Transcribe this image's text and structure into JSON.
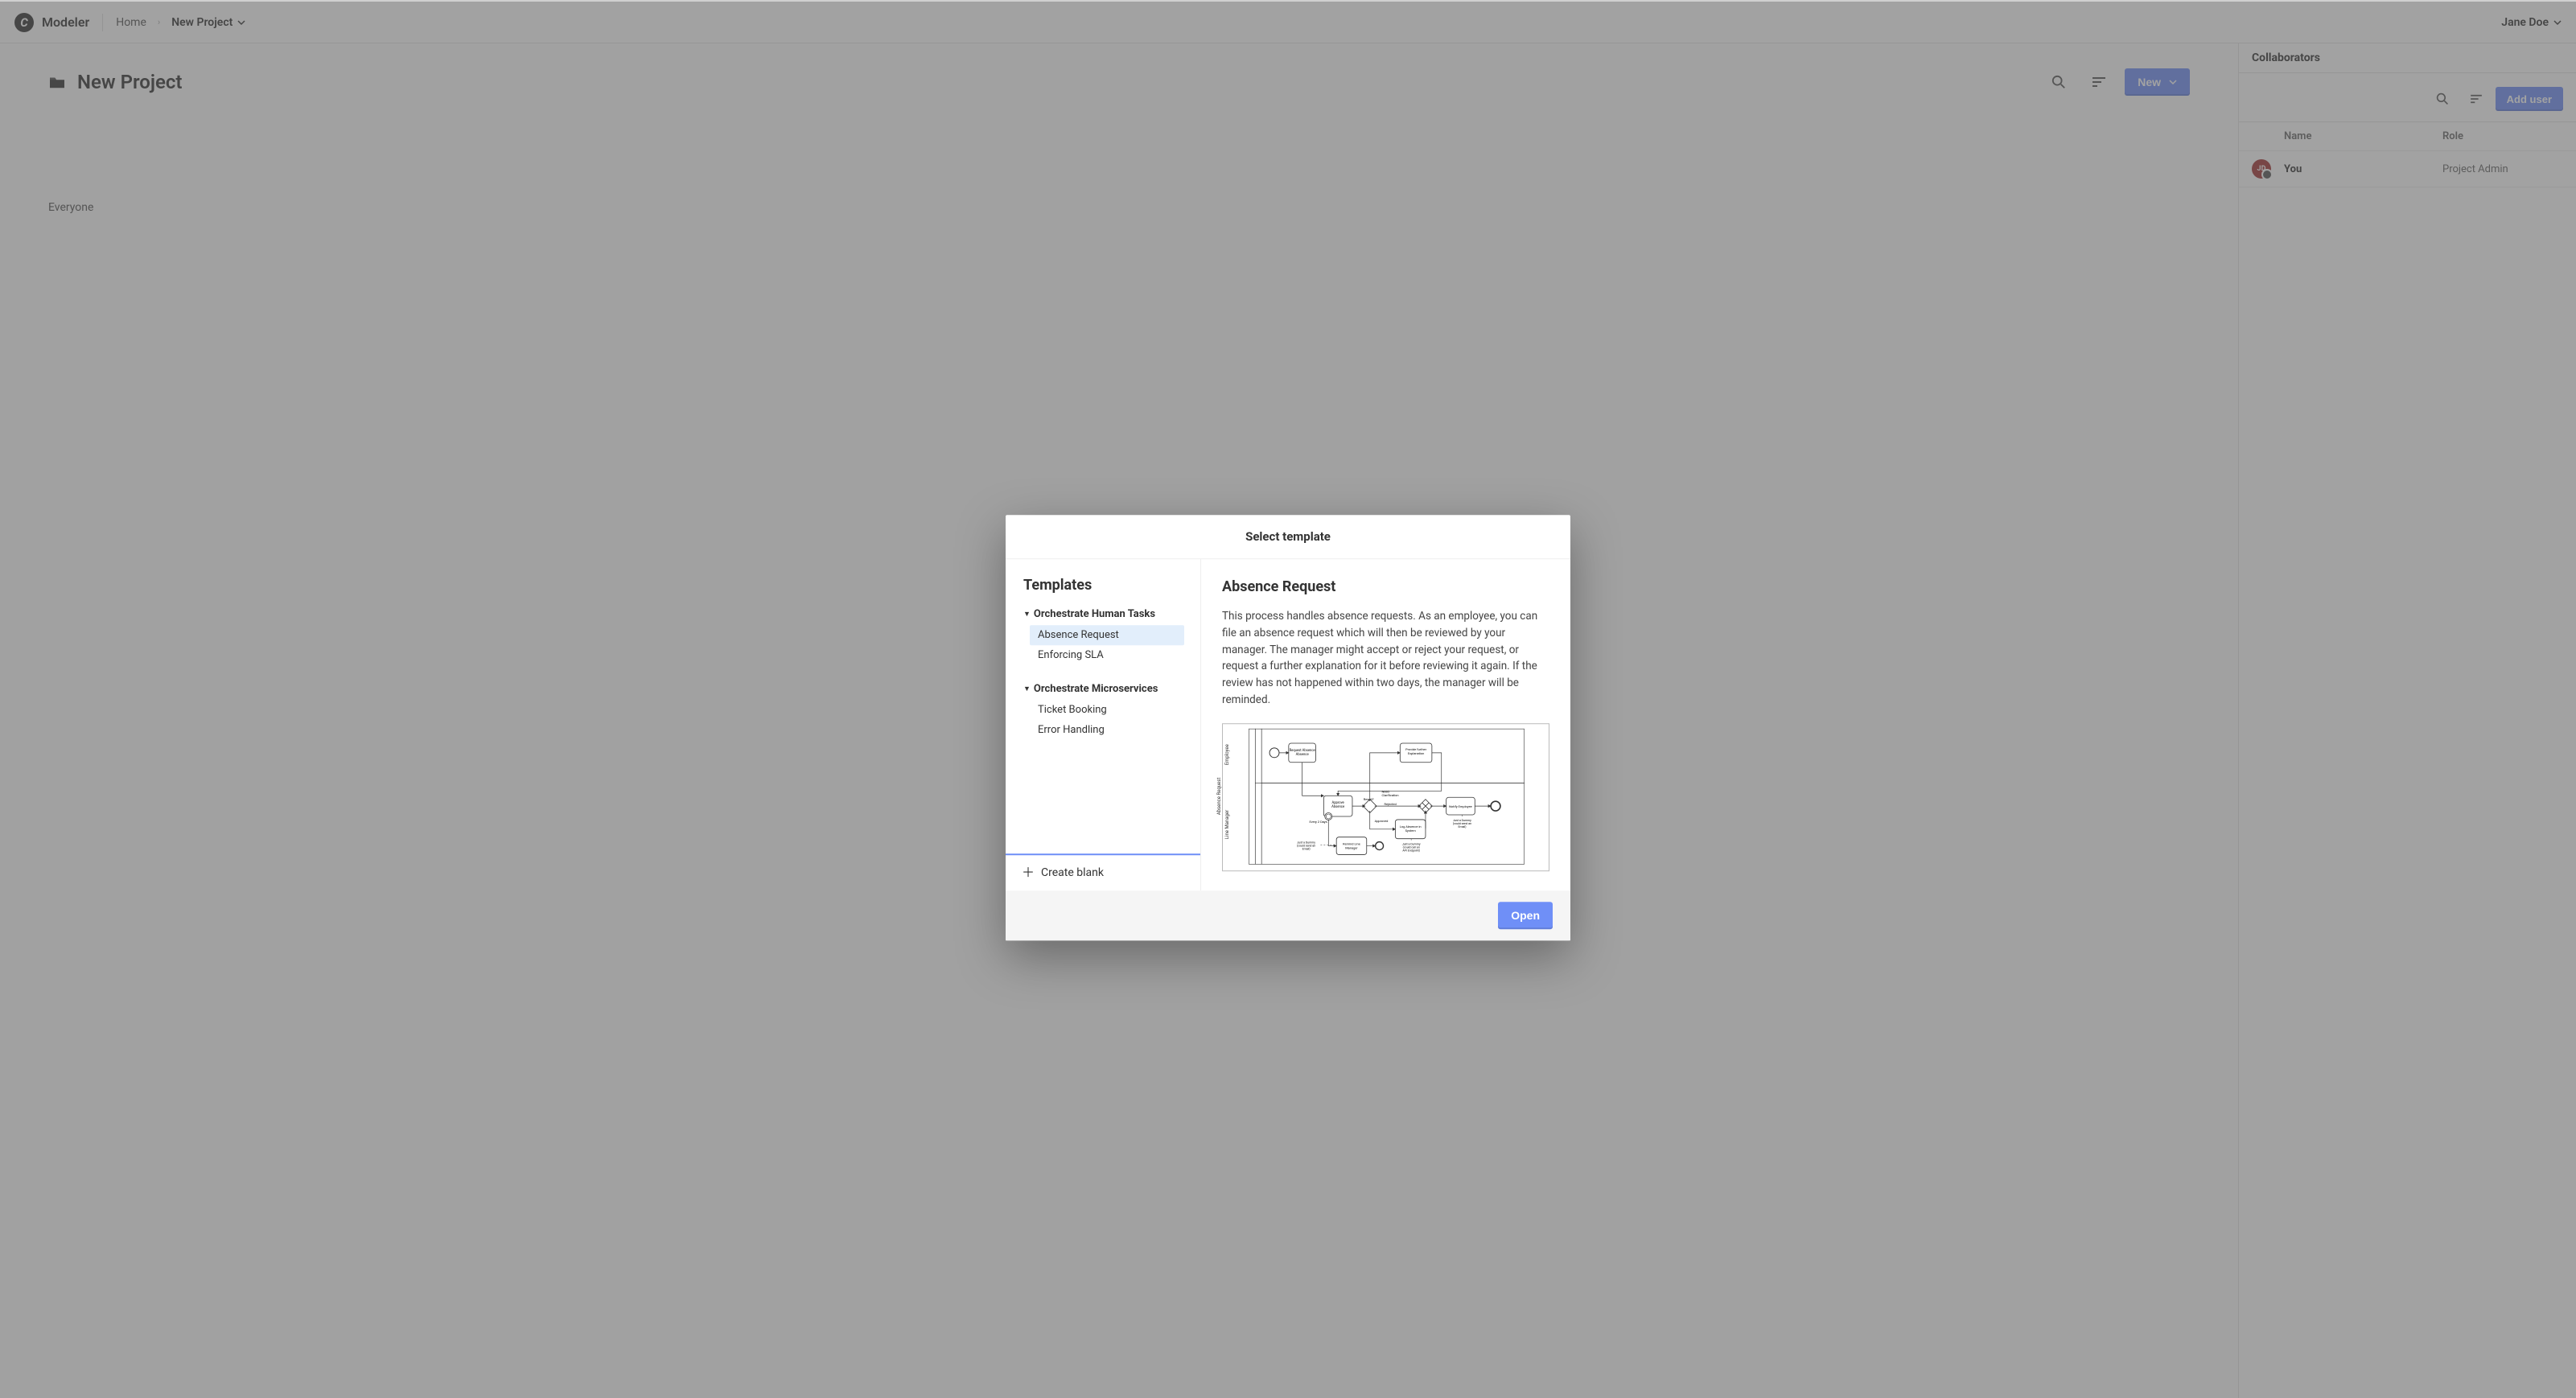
{
  "topnav": {
    "brand_name": "Modeler",
    "brand_initial": "C",
    "home_label": "Home",
    "current_label": "New Project",
    "user_name": "Jane Doe"
  },
  "content": {
    "title": "New Project",
    "new_button": "New",
    "empty_message": "Everyone"
  },
  "collaborators": {
    "panel_title": "Collaborators",
    "add_user_label": "Add user",
    "col_name": "Name",
    "col_role": "Role",
    "rows": [
      {
        "initials": "JD",
        "name": "You",
        "role": "Project Admin"
      }
    ]
  },
  "modal": {
    "title": "Select template",
    "templates_heading": "Templates",
    "create_blank_label": "Create blank",
    "open_label": "Open",
    "groups": [
      {
        "title": "Orchestrate Human Tasks",
        "items": [
          "Absence Request",
          "Enforcing SLA"
        ],
        "selected_index": 0
      },
      {
        "title": "Orchestrate Microservices",
        "items": [
          "Ticket Booking",
          "Error Handling"
        ],
        "selected_index": -1
      }
    ],
    "detail": {
      "title": "Absence Request",
      "description": "This process handles absence requests. As an employee, you can file an absence request which will then be reviewed by your manager. The manager might accept or reject your request, or request a further explanation for it before reviewing it again. If the review has not happened within two days, the manager will be reminded.",
      "lanes": {
        "pool": "Absence Request",
        "top": "Employee",
        "bottom": "Line Manager"
      },
      "nodes": {
        "request_absence": "Request Absence",
        "provide_further": "Provide further Explanation",
        "approve_absence": "Approve Absence",
        "every_2_days": "Every 2 Days",
        "need_clarification": "Need Clarification",
        "result": "Result?",
        "rejected": "Rejected",
        "approved": "Approved",
        "remind_line_manager": "Remind Line Manager",
        "log_absence": "Log Absence in System",
        "notify_employee": "Notify Employee",
        "dummy_email_left": "Just a Dummy (could send an Email)",
        "dummy_api": "Just a Dummy (could call an API Endpoint)",
        "dummy_email_right": "Just a Dummy (could send an Email)"
      }
    }
  }
}
